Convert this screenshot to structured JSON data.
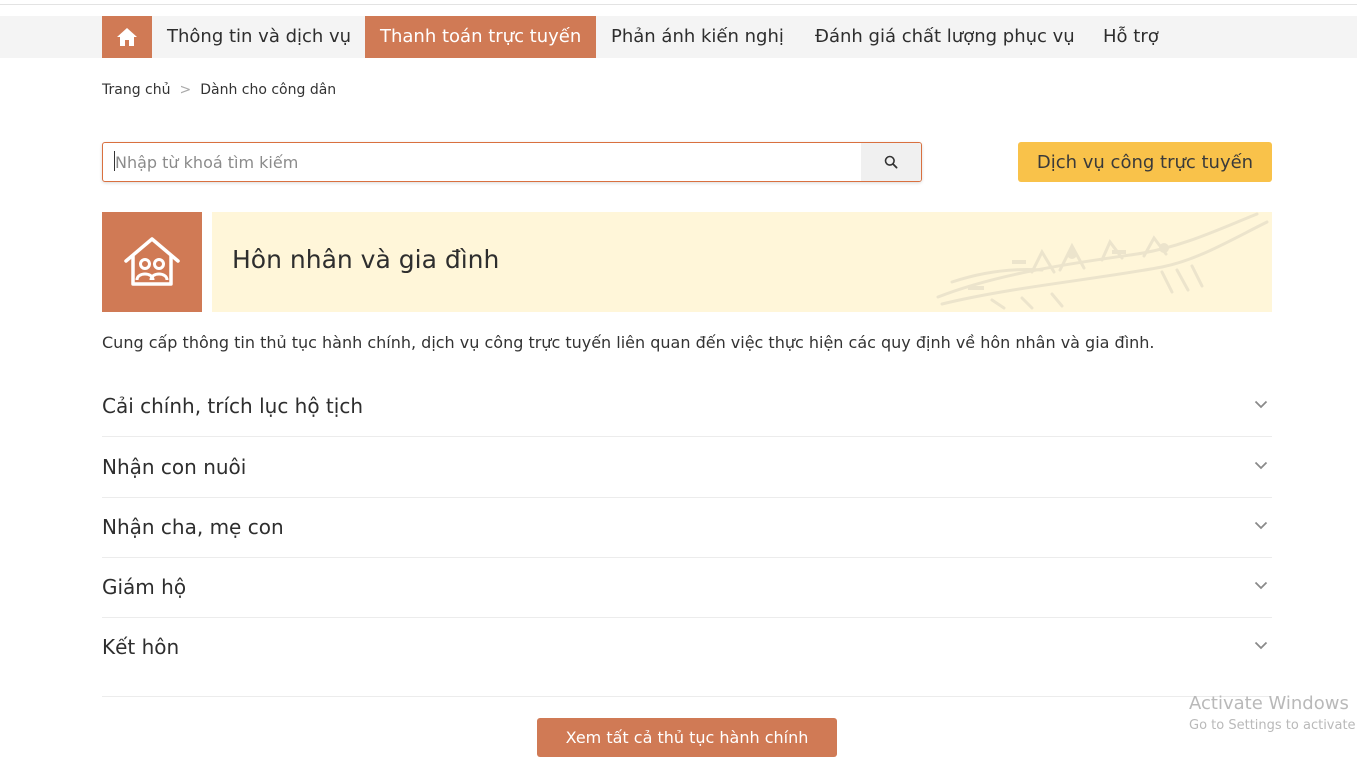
{
  "nav": {
    "items": [
      {
        "label": "Thông tin và dịch vụ"
      },
      {
        "label": "Thanh toán trực tuyến"
      },
      {
        "label": "Phản ánh kiến nghị"
      },
      {
        "label": "Đánh giá chất lượng phục vụ"
      },
      {
        "label": "Hỗ trợ"
      }
    ],
    "active_index": 1,
    "home_icon": "home-icon"
  },
  "breadcrumb": {
    "items": [
      "Trang chủ",
      "Dành cho công dân"
    ],
    "separator": ">"
  },
  "search": {
    "placeholder": "Nhập từ khoá tìm kiếm",
    "value": "",
    "button_icon": "search-icon"
  },
  "service_button": {
    "label": "Dịch vụ công trực tuyến"
  },
  "category": {
    "title": "Hôn nhân và gia đình",
    "icon": "family-house-icon",
    "description": "Cung cấp thông tin thủ tục hành chính, dịch vụ công trực tuyến liên quan đến việc thực hiện các quy định về hôn nhân và gia đình."
  },
  "accordion": [
    {
      "label": "Cải chính, trích lục hộ tịch"
    },
    {
      "label": "Nhận con nuôi"
    },
    {
      "label": "Nhận cha, mẹ con"
    },
    {
      "label": "Giám hộ"
    },
    {
      "label": "Kết hôn"
    }
  ],
  "view_all_button": {
    "label": "Xem tất cả thủ tục hành chính"
  },
  "watermark": {
    "title": "Activate Windows",
    "subtitle": "Go to Settings to activate"
  },
  "colors": {
    "accent": "#d07a55",
    "service_button": "#f9c24a",
    "banner_bg": "#fff6d9",
    "search_border": "#d9703f"
  }
}
